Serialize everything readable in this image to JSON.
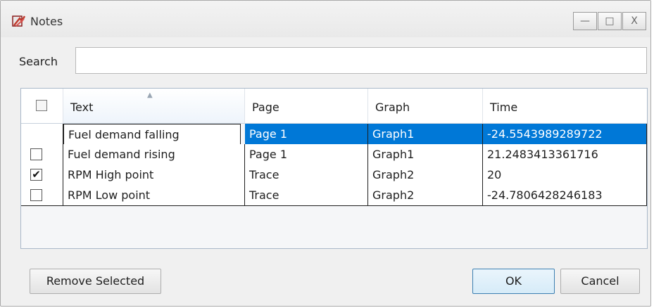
{
  "window": {
    "title": "Notes",
    "controls": {
      "minimize": "—",
      "maximize": "□",
      "close": "X"
    }
  },
  "search": {
    "label": "Search",
    "value": ""
  },
  "table": {
    "columns": [
      "Text",
      "Page",
      "Graph",
      "Time"
    ],
    "rows": [
      {
        "checked": false,
        "selected": true,
        "editing": true,
        "text": "Fuel demand falling",
        "page": "Page 1",
        "graph": "Graph1",
        "time": "-24.5543989289722"
      },
      {
        "checked": false,
        "selected": false,
        "editing": false,
        "text": "Fuel demand rising",
        "page": "Page 1",
        "graph": "Graph1",
        "time": "21.2483413361716"
      },
      {
        "checked": true,
        "selected": false,
        "editing": false,
        "text": "RPM High point",
        "page": "Trace",
        "graph": "Graph2",
        "time": "20"
      },
      {
        "checked": false,
        "selected": false,
        "editing": false,
        "text": "RPM Low point",
        "page": "Trace",
        "graph": "Graph2",
        "time": "-24.7806428246183"
      }
    ]
  },
  "buttons": {
    "remove": "Remove Selected",
    "ok": "OK",
    "cancel": "Cancel"
  },
  "colors": {
    "selection": "#0078d7",
    "ok_border": "#3c7fb1"
  },
  "icons": {
    "app": "notes-app-icon",
    "sort": "sort-ascending-icon",
    "check": "checkmark-icon"
  }
}
